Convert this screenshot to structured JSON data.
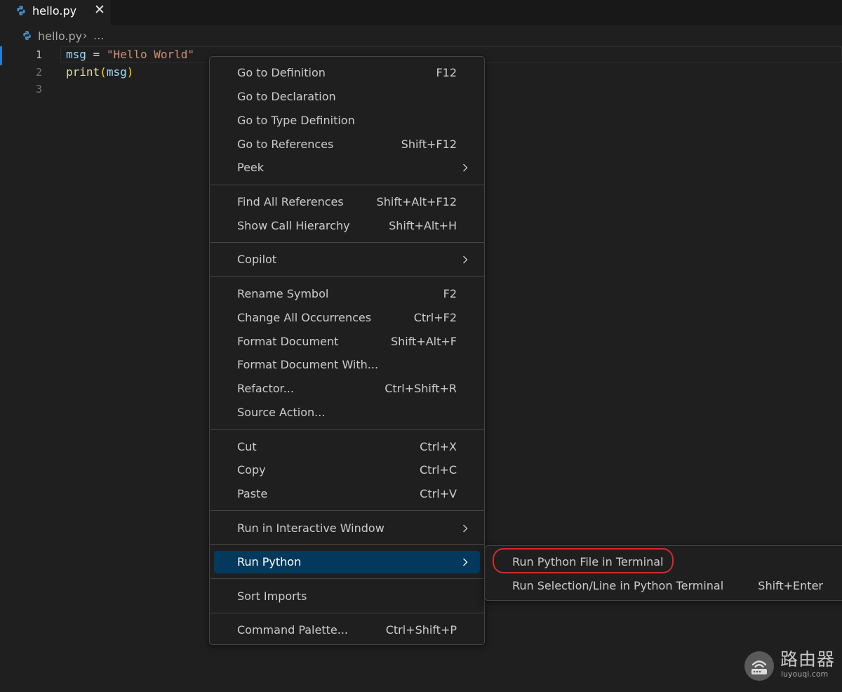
{
  "tab": {
    "label": "hello.py",
    "close_glyph": "✕",
    "icon": "python-icon"
  },
  "breadcrumb": {
    "file": "hello.py",
    "separator": "›",
    "more": "..."
  },
  "editor": {
    "active_line": 1,
    "lines": [
      {
        "number": "1",
        "tokens": [
          {
            "text": "msg",
            "kind": "var"
          },
          {
            "text": " = ",
            "kind": "op"
          },
          {
            "text": "\"Hello World\"",
            "kind": "str"
          }
        ]
      },
      {
        "number": "2",
        "tokens": [
          {
            "text": "print",
            "kind": "fn"
          },
          {
            "text": "(",
            "kind": "paren"
          },
          {
            "text": "msg",
            "kind": "var"
          },
          {
            "text": ")",
            "kind": "paren"
          }
        ]
      },
      {
        "number": "3",
        "tokens": []
      }
    ]
  },
  "context_menu": {
    "items": [
      {
        "label": "Go to Definition",
        "shortcut": "F12"
      },
      {
        "label": "Go to Declaration",
        "shortcut": ""
      },
      {
        "label": "Go to Type Definition",
        "shortcut": ""
      },
      {
        "label": "Go to References",
        "shortcut": "Shift+F12"
      },
      {
        "label": "Peek",
        "shortcut": "",
        "submenu": true
      },
      {
        "label": "Find All References",
        "shortcut": "Shift+Alt+F12"
      },
      {
        "label": "Show Call Hierarchy",
        "shortcut": "Shift+Alt+H"
      },
      {
        "label": "Copilot",
        "shortcut": "",
        "submenu": true
      },
      {
        "label": "Rename Symbol",
        "shortcut": "F2"
      },
      {
        "label": "Change All Occurrences",
        "shortcut": "Ctrl+F2"
      },
      {
        "label": "Format Document",
        "shortcut": "Shift+Alt+F"
      },
      {
        "label": "Format Document With...",
        "shortcut": ""
      },
      {
        "label": "Refactor...",
        "shortcut": "Ctrl+Shift+R"
      },
      {
        "label": "Source Action...",
        "shortcut": ""
      },
      {
        "label": "Cut",
        "shortcut": "Ctrl+X"
      },
      {
        "label": "Copy",
        "shortcut": "Ctrl+C"
      },
      {
        "label": "Paste",
        "shortcut": "Ctrl+V"
      },
      {
        "label": "Run in Interactive Window",
        "shortcut": "",
        "submenu": true
      },
      {
        "label": "Run Python",
        "shortcut": "",
        "submenu": true,
        "selected": true
      },
      {
        "label": "Sort Imports",
        "shortcut": ""
      },
      {
        "label": "Command Palette...",
        "shortcut": "Ctrl+Shift+P"
      }
    ]
  },
  "submenu": {
    "items": [
      {
        "label": "Run Python File in Terminal",
        "shortcut": "",
        "highlighted": true
      },
      {
        "label": "Run Selection/Line in Python Terminal",
        "shortcut": "Shift+Enter"
      }
    ]
  },
  "watermark": {
    "brand": "路由器",
    "url": "luyouqi.com"
  },
  "colors": {
    "editor_bg": "#1f1f1f",
    "tabbar_bg": "#181818",
    "menu_selected": "#04395e",
    "highlight_ring": "#d22a2a",
    "accent": "#2b79d1"
  }
}
